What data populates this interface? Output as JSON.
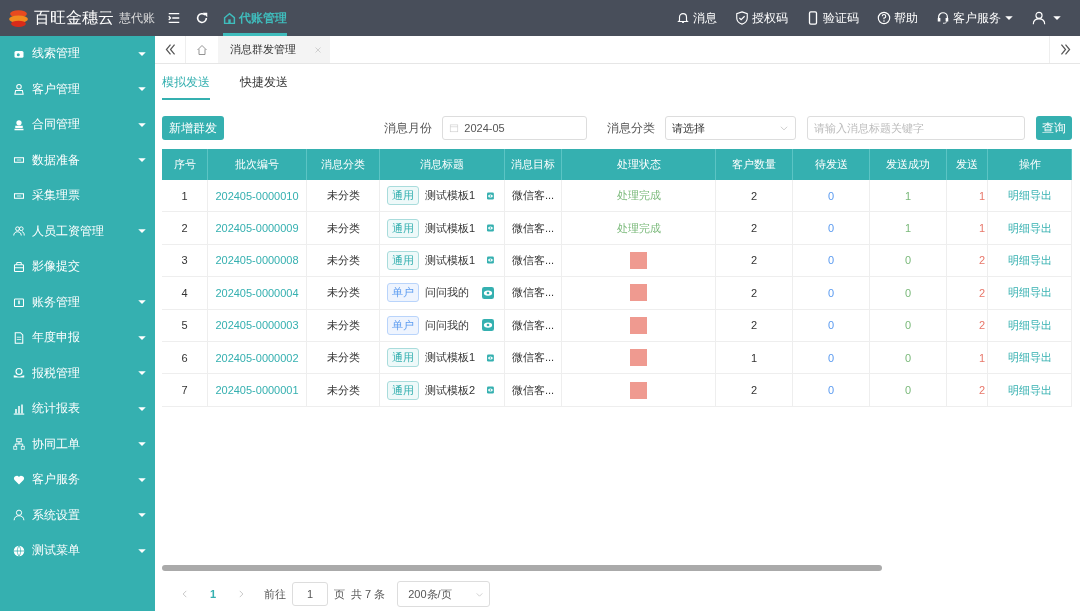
{
  "header": {
    "logo_text": "百旺金穗云",
    "product": "慧代账",
    "module_tab": {
      "label": "代账管理",
      "selected": true
    },
    "actions": [
      {
        "label": "消息",
        "dropdown": false
      },
      {
        "label": "授权码",
        "dropdown": false
      },
      {
        "label": "验证码",
        "dropdown": false
      },
      {
        "label": "帮助",
        "dropdown": false
      },
      {
        "label": "客户服务",
        "dropdown": true
      }
    ]
  },
  "sidebar": {
    "items": [
      {
        "label": "线索管理",
        "expandable": true
      },
      {
        "label": "客户管理",
        "expandable": true
      },
      {
        "label": "合同管理",
        "expandable": true
      },
      {
        "label": "数据准备",
        "expandable": true
      },
      {
        "label": "采集理票",
        "expandable": false
      },
      {
        "label": "人员工资管理",
        "expandable": true
      },
      {
        "label": "影像提交",
        "expandable": false
      },
      {
        "label": "账务管理",
        "expandable": true
      },
      {
        "label": "年度申报",
        "expandable": true
      },
      {
        "label": "报税管理",
        "expandable": true
      },
      {
        "label": "统计报表",
        "expandable": true
      },
      {
        "label": "协同工单",
        "expandable": true
      },
      {
        "label": "客户服务",
        "expandable": true
      },
      {
        "label": "系统设置",
        "expandable": true
      },
      {
        "label": "测试菜单",
        "expandable": true
      }
    ]
  },
  "page_tabs": [
    {
      "label": "消息群发管理"
    }
  ],
  "sub_tabs": [
    {
      "label": "模拟发送",
      "selected": true
    },
    {
      "label": "快捷发送",
      "selected": false
    }
  ],
  "toolbar": {
    "add_button": "新增群发",
    "month_label": "消息月份",
    "month_value": "2024-05",
    "category_label": "消息分类",
    "category_value": "请选择",
    "search_placeholder": "请输入消息标题关键字",
    "query_button": "查询"
  },
  "table": {
    "columns": [
      "序号",
      "批次编号",
      "消息分类",
      "消息标题",
      "消息目标",
      "处理状态",
      "客户数量",
      "待发送",
      "发送成功",
      "发送",
      "操作"
    ],
    "rows": [
      {
        "index": "1",
        "batch": "202405-0000010",
        "category": "未分类",
        "tag": {
          "label": "通用",
          "kind": "general"
        },
        "title": "测试模板1",
        "target": "微信客...",
        "status": "处理完成",
        "status_redacted": false,
        "customers": "2",
        "pending": "0",
        "success": "1",
        "failed": "1",
        "action": "明细导出"
      },
      {
        "index": "2",
        "batch": "202405-0000009",
        "category": "未分类",
        "tag": {
          "label": "通用",
          "kind": "general"
        },
        "title": "测试模板1",
        "target": "微信客...",
        "status": "处理完成",
        "status_redacted": false,
        "customers": "2",
        "pending": "0",
        "success": "1",
        "failed": "1",
        "action": "明细导出"
      },
      {
        "index": "3",
        "batch": "202405-0000008",
        "category": "未分类",
        "tag": {
          "label": "通用",
          "kind": "general"
        },
        "title": "测试模板1",
        "target": "微信客...",
        "status_redacted": true,
        "customers": "2",
        "pending": "0",
        "success": "0",
        "failed": "2",
        "action": "明细导出"
      },
      {
        "index": "4",
        "batch": "202405-0000004",
        "category": "未分类",
        "tag": {
          "label": "单户",
          "kind": "single"
        },
        "title": "问问我的",
        "target": "微信客...",
        "status_redacted": true,
        "customers": "2",
        "pending": "0",
        "success": "0",
        "failed": "2",
        "action": "明细导出"
      },
      {
        "index": "5",
        "batch": "202405-0000003",
        "category": "未分类",
        "tag": {
          "label": "单户",
          "kind": "single"
        },
        "title": "问问我的",
        "target": "微信客...",
        "status_redacted": true,
        "customers": "2",
        "pending": "0",
        "success": "0",
        "failed": "2",
        "action": "明细导出"
      },
      {
        "index": "6",
        "batch": "202405-0000002",
        "category": "未分类",
        "tag": {
          "label": "通用",
          "kind": "general"
        },
        "title": "测试模板1",
        "target": "微信客...",
        "status_redacted": true,
        "customers": "1",
        "pending": "0",
        "success": "0",
        "failed": "1",
        "action": "明细导出"
      },
      {
        "index": "7",
        "batch": "202405-0000001",
        "category": "未分类",
        "tag": {
          "label": "通用",
          "kind": "general"
        },
        "title": "测试模板2",
        "target": "微信客...",
        "status_redacted": true,
        "customers": "2",
        "pending": "0",
        "success": "0",
        "failed": "2",
        "action": "明细导出"
      }
    ]
  },
  "pagination": {
    "page": "1",
    "goto_label": "前往",
    "goto_value": "1",
    "page_unit": "页",
    "total": "共 7 条",
    "page_size": "200条/页"
  }
}
